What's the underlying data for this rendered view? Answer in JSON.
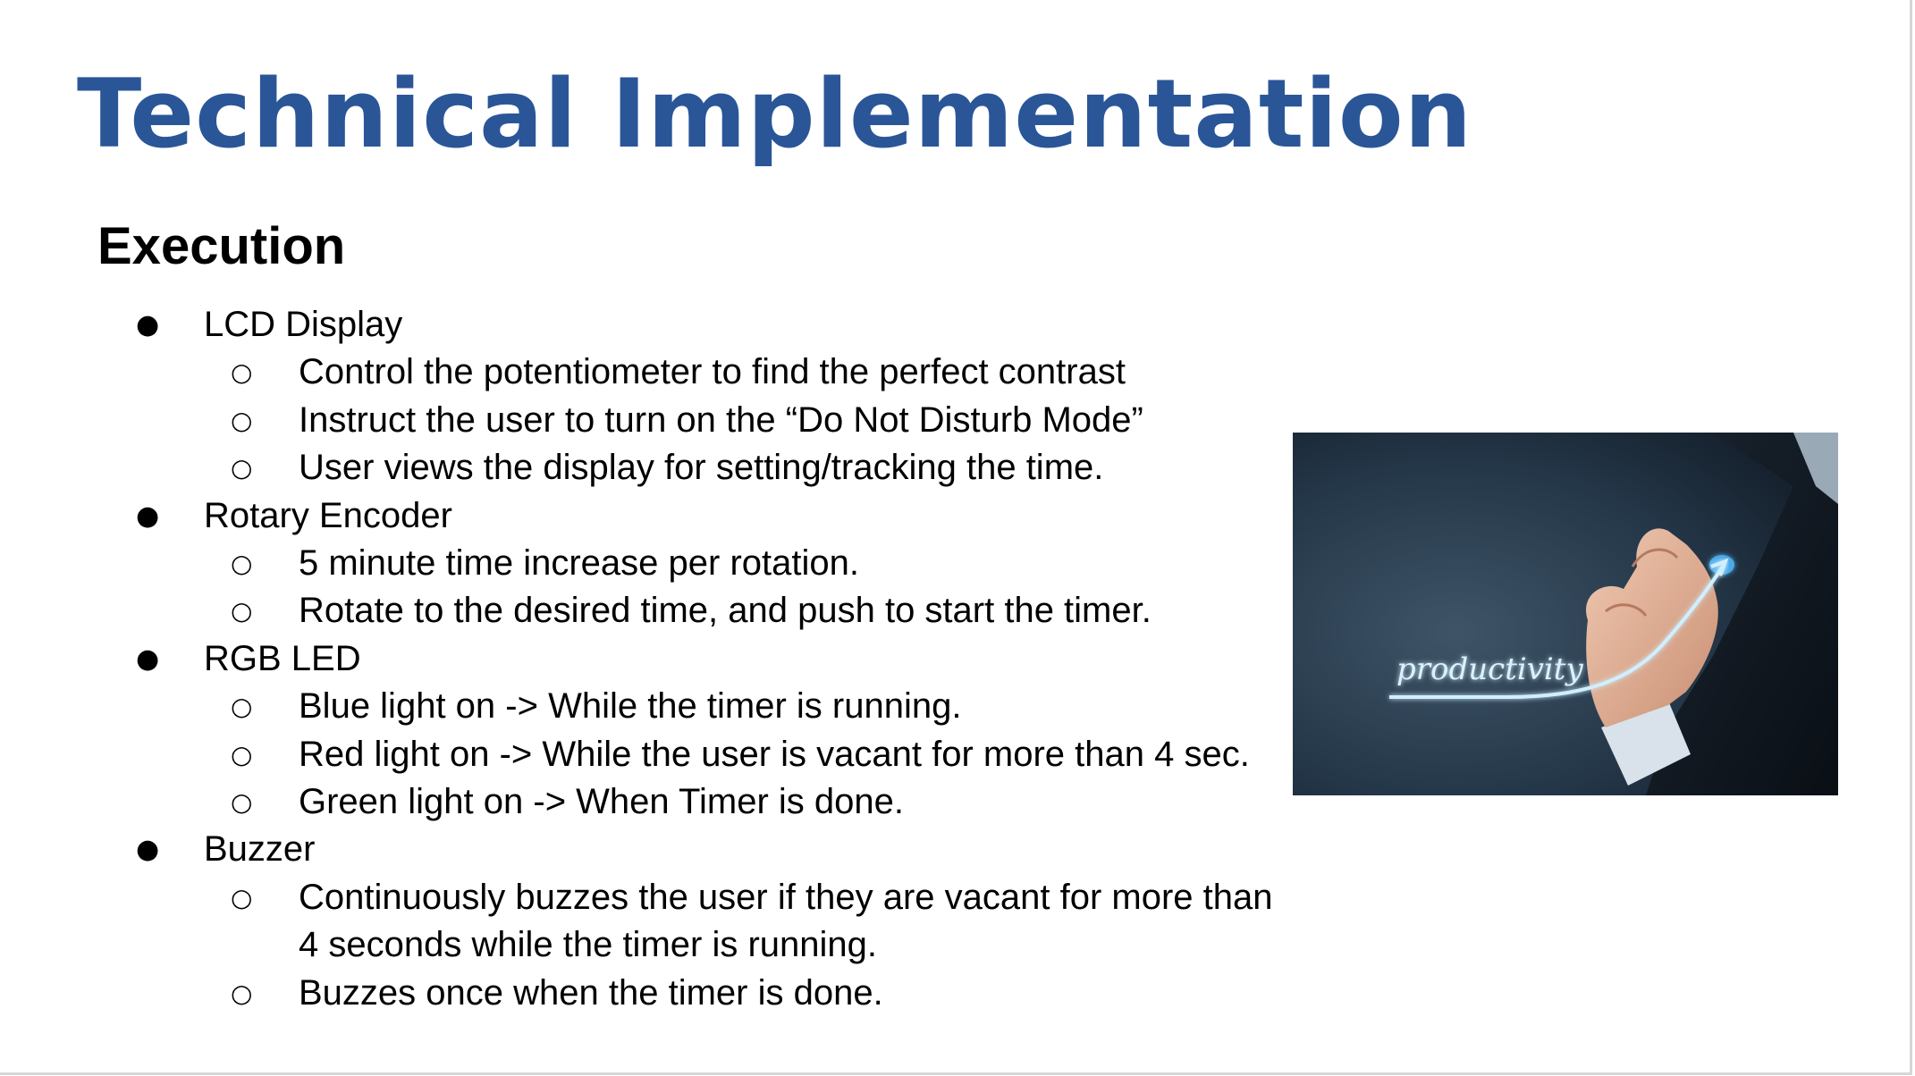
{
  "slide": {
    "title": "Technical Implementation",
    "section_heading": "Execution",
    "bullet_markers": {
      "level1": "●",
      "level2": "○"
    },
    "items": [
      {
        "label": "LCD Display",
        "subitems": [
          "Control the potentiometer to find the perfect contrast",
          "Instruct the user to turn on the “Do Not Disturb Mode”",
          "User views the display for setting/tracking the time."
        ]
      },
      {
        "label": "Rotary Encoder",
        "subitems": [
          "5 minute time increase per rotation.",
          "Rotate to the desired time, and push to start the timer."
        ]
      },
      {
        "label": "RGB LED",
        "subitems": [
          "Blue light on -> While the timer is running.",
          "Red light on -> While the user is vacant for more than 4 sec.",
          "Green light on -> When Timer is done."
        ]
      },
      {
        "label": "Buzzer",
        "subitems": [
          "Continuously buzzes the user if they are  vacant for more than 4 seconds while the timer is running.",
          "Buzzes once when the timer is done."
        ]
      }
    ],
    "image": {
      "caption_text": "productivity",
      "description_icon": "hand-drawing-growth-curve-image"
    },
    "colors": {
      "title": "#2a5698",
      "text": "#000000",
      "background": "#ffffff",
      "image_glow": "#bfefff"
    }
  }
}
